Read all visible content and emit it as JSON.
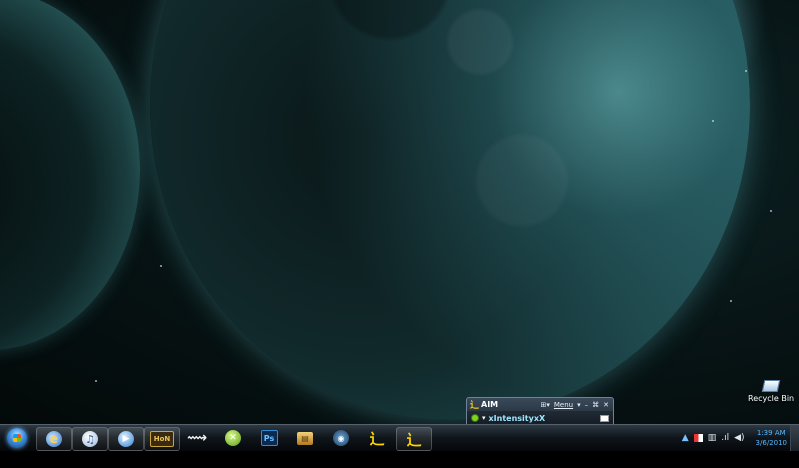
{
  "desktop": {
    "icons": [
      {
        "label": "Recycle Bin",
        "icon": "recycle-bin-icon"
      }
    ]
  },
  "aim_window": {
    "title": "AIM",
    "menu_label": "Menu",
    "screen_name": "xIntensityxX",
    "status": "online"
  },
  "taskbar": {
    "items": [
      {
        "name": "Internet Explorer",
        "icon": "ie-icon"
      },
      {
        "name": "iTunes",
        "icon": "itunes-icon"
      },
      {
        "name": "Windows Media Player",
        "icon": "wmp-icon"
      },
      {
        "name": "HoN",
        "icon": "hon-icon"
      },
      {
        "name": "Steam",
        "icon": "steam-icon"
      },
      {
        "name": "Xbox",
        "icon": "xbox-icon"
      },
      {
        "name": "Ps",
        "icon": "photoshop-icon"
      },
      {
        "name": "Archive",
        "icon": "archive-icon"
      },
      {
        "name": "Media",
        "icon": "media-icon"
      },
      {
        "name": "AIM",
        "icon": "aim-icon"
      },
      {
        "name": "AIM",
        "icon": "aim-icon"
      }
    ],
    "clock": {
      "time": "1:39 AM",
      "date": "3/6/2010"
    }
  },
  "colors": {
    "accent": "#56b6ff",
    "aim_yellow": "#ffd400",
    "online_green": "#7ed321"
  }
}
